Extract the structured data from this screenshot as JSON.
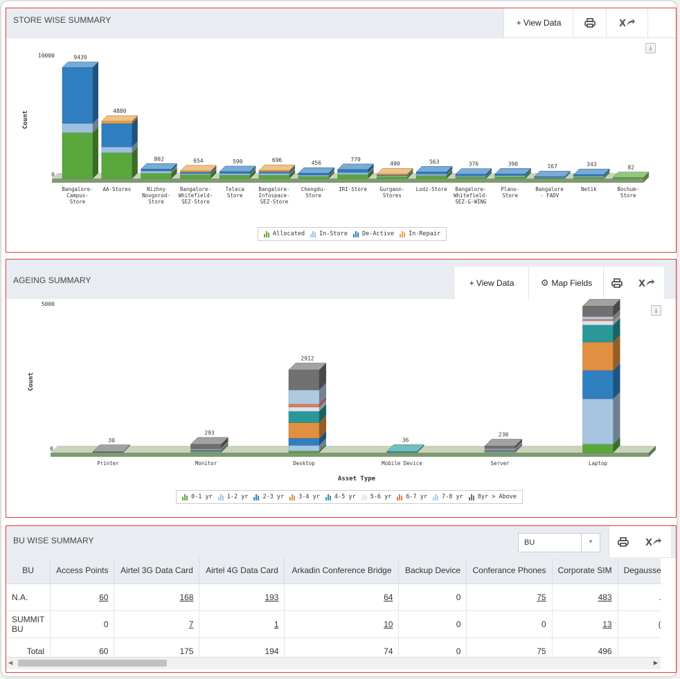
{
  "store_panel": {
    "title": "STORE WISE SUMMARY",
    "view_data_label": "+ View Data",
    "icons": [
      "print-icon",
      "export-excel-icon",
      "download-icon"
    ]
  },
  "ageing_panel": {
    "title": "AGEING SUMMARY",
    "view_data_label": "+ View Data",
    "map_fields_label": "Map Fields",
    "icons": [
      "print-icon",
      "export-excel-icon",
      "gear-icon",
      "download-icon"
    ]
  },
  "bu_panel": {
    "title": "BU WISE SUMMARY",
    "select_value": "BU",
    "columns": [
      "BU",
      "Access Points",
      "Airtel 3G Data Card",
      "Airtel 4G Data Card",
      "Arkadin Conference Bridge",
      "Backup Device",
      "Conferance Phones",
      "Corporate SIM",
      "Degausse"
    ],
    "rows": [
      {
        "bu": "N.A.",
        "cells": [
          "60",
          "168",
          "193",
          "64",
          "0",
          "75",
          "483",
          "."
        ],
        "links": [
          true,
          true,
          true,
          true,
          false,
          true,
          true,
          false
        ]
      },
      {
        "bu": "SUMMIT BU",
        "cells": [
          "0",
          "7",
          "1",
          "10",
          "0",
          "0",
          "13",
          "("
        ],
        "links": [
          false,
          true,
          true,
          true,
          false,
          false,
          true,
          false
        ]
      },
      {
        "bu": "Total",
        "cells": [
          "60",
          "175",
          "194",
          "74",
          "0",
          "75",
          "496",
          ""
        ],
        "links": [
          false,
          false,
          false,
          false,
          false,
          false,
          false,
          false
        ]
      }
    ]
  },
  "chart_data": [
    {
      "type": "bar",
      "stacked": true,
      "title": "",
      "xlabel": "Asset Type",
      "ylabel": "Count",
      "ylim": [
        0,
        10000
      ],
      "y_ticks": [
        "0",
        "10000"
      ],
      "categories": [
        "Bangalore-Campus-Store",
        "AA-Stores",
        "Nizhny Novgorod-Store",
        "Bangalore-Whitefield-SEZ-Store",
        "Teleca Store",
        "Bangalore-Infospace-SEZ-Store",
        "Chengdu-Store",
        "IRI-Store",
        "Gurgaon-Stores",
        "Lodz-Store",
        "Bangalore-Whitefield-SEZ-G-WING",
        "Plano-Store",
        "Bangalore - FADV",
        "Netik",
        "Bochum-Store"
      ],
      "totals": [
        9439,
        4880,
        802,
        654,
        590,
        696,
        456,
        770,
        400,
        563,
        376,
        390,
        167,
        343,
        82
      ],
      "series": [
        {
          "name": "Allocated",
          "color": "#5aa83c",
          "values": [
            3900,
            2200,
            450,
            330,
            300,
            300,
            200,
            350,
            180,
            260,
            150,
            170,
            60,
            120,
            82
          ]
        },
        {
          "name": "In-Store",
          "color": "#9ec0e0",
          "values": [
            800,
            500,
            200,
            100,
            140,
            150,
            100,
            170,
            70,
            130,
            80,
            90,
            50,
            90,
            0
          ]
        },
        {
          "name": "De-Active",
          "color": "#2f7ec0",
          "values": [
            4739,
            1980,
            152,
            124,
            150,
            146,
            156,
            250,
            50,
            173,
            146,
            130,
            57,
            133,
            0
          ]
        },
        {
          "name": "In-Repair",
          "color": "#e8a048",
          "values": [
            0,
            200,
            0,
            100,
            0,
            100,
            0,
            0,
            100,
            0,
            0,
            0,
            0,
            0,
            0
          ]
        }
      ]
    },
    {
      "type": "bar",
      "stacked": true,
      "title": "",
      "xlabel": "Asset Type",
      "ylabel": "Count",
      "ylim": [
        0,
        5000
      ],
      "y_ticks": [
        "0",
        "5000"
      ],
      "categories": [
        "Printer",
        "Monitor",
        "Desktop",
        "Mobile Device",
        "Server",
        "Laptop"
      ],
      "totals": [
        30,
        293,
        2912,
        36,
        230,
        4459
      ],
      "series": [
        {
          "name": "0-1 yr",
          "color": "#5aa83c",
          "values": [
            0,
            10,
            60,
            0,
            10,
            300
          ]
        },
        {
          "name": "1-2 yr",
          "color": "#a7c4e0",
          "values": [
            5,
            30,
            200,
            0,
            30,
            1600
          ]
        },
        {
          "name": "2-3 yr",
          "color": "#2f7ec0",
          "values": [
            5,
            30,
            250,
            0,
            30,
            1000
          ]
        },
        {
          "name": "3-4 yr",
          "color": "#e09040",
          "values": [
            0,
            20,
            550,
            0,
            20,
            1000
          ]
        },
        {
          "name": "4-5 yr",
          "color": "#2a9898",
          "values": [
            0,
            20,
            400,
            36,
            10,
            600
          ]
        },
        {
          "name": "5-6 yr",
          "color": "#d8e4ee",
          "values": [
            0,
            20,
            150,
            0,
            20,
            150
          ]
        },
        {
          "name": "6-7 yr",
          "color": "#e87850",
          "values": [
            0,
            10,
            100,
            0,
            10,
            50
          ]
        },
        {
          "name": "7-8 yr",
          "color": "#b0c8e0",
          "values": [
            0,
            13,
            502,
            0,
            20,
            100
          ]
        },
        {
          "name": "8yr > Above",
          "color": "#707070",
          "values": [
            20,
            140,
            700,
            0,
            80,
            359
          ]
        }
      ]
    }
  ]
}
